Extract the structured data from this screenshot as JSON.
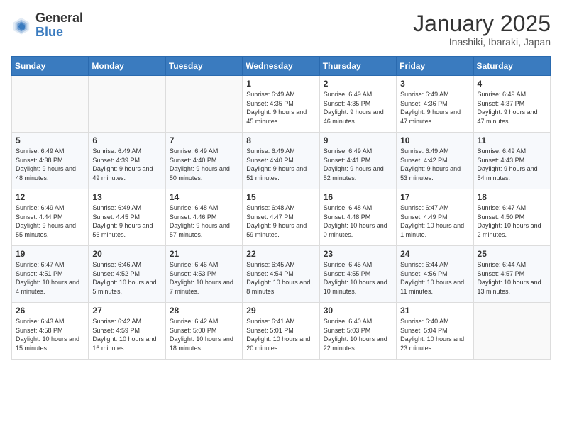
{
  "logo": {
    "general": "General",
    "blue": "Blue"
  },
  "header": {
    "title": "January 2025",
    "subtitle": "Inashiki, Ibaraki, Japan"
  },
  "weekdays": [
    "Sunday",
    "Monday",
    "Tuesday",
    "Wednesday",
    "Thursday",
    "Friday",
    "Saturday"
  ],
  "weeks": [
    [
      {
        "day": "",
        "empty": true
      },
      {
        "day": "",
        "empty": true
      },
      {
        "day": "",
        "empty": true
      },
      {
        "day": "1",
        "sunrise": "6:49 AM",
        "sunset": "4:35 PM",
        "daylight": "9 hours and 45 minutes."
      },
      {
        "day": "2",
        "sunrise": "6:49 AM",
        "sunset": "4:35 PM",
        "daylight": "9 hours and 46 minutes."
      },
      {
        "day": "3",
        "sunrise": "6:49 AM",
        "sunset": "4:36 PM",
        "daylight": "9 hours and 47 minutes."
      },
      {
        "day": "4",
        "sunrise": "6:49 AM",
        "sunset": "4:37 PM",
        "daylight": "9 hours and 47 minutes."
      }
    ],
    [
      {
        "day": "5",
        "sunrise": "6:49 AM",
        "sunset": "4:38 PM",
        "daylight": "9 hours and 48 minutes."
      },
      {
        "day": "6",
        "sunrise": "6:49 AM",
        "sunset": "4:39 PM",
        "daylight": "9 hours and 49 minutes."
      },
      {
        "day": "7",
        "sunrise": "6:49 AM",
        "sunset": "4:40 PM",
        "daylight": "9 hours and 50 minutes."
      },
      {
        "day": "8",
        "sunrise": "6:49 AM",
        "sunset": "4:40 PM",
        "daylight": "9 hours and 51 minutes."
      },
      {
        "day": "9",
        "sunrise": "6:49 AM",
        "sunset": "4:41 PM",
        "daylight": "9 hours and 52 minutes."
      },
      {
        "day": "10",
        "sunrise": "6:49 AM",
        "sunset": "4:42 PM",
        "daylight": "9 hours and 53 minutes."
      },
      {
        "day": "11",
        "sunrise": "6:49 AM",
        "sunset": "4:43 PM",
        "daylight": "9 hours and 54 minutes."
      }
    ],
    [
      {
        "day": "12",
        "sunrise": "6:49 AM",
        "sunset": "4:44 PM",
        "daylight": "9 hours and 55 minutes."
      },
      {
        "day": "13",
        "sunrise": "6:49 AM",
        "sunset": "4:45 PM",
        "daylight": "9 hours and 56 minutes."
      },
      {
        "day": "14",
        "sunrise": "6:48 AM",
        "sunset": "4:46 PM",
        "daylight": "9 hours and 57 minutes."
      },
      {
        "day": "15",
        "sunrise": "6:48 AM",
        "sunset": "4:47 PM",
        "daylight": "9 hours and 59 minutes."
      },
      {
        "day": "16",
        "sunrise": "6:48 AM",
        "sunset": "4:48 PM",
        "daylight": "10 hours and 0 minutes."
      },
      {
        "day": "17",
        "sunrise": "6:47 AM",
        "sunset": "4:49 PM",
        "daylight": "10 hours and 1 minute."
      },
      {
        "day": "18",
        "sunrise": "6:47 AM",
        "sunset": "4:50 PM",
        "daylight": "10 hours and 2 minutes."
      }
    ],
    [
      {
        "day": "19",
        "sunrise": "6:47 AM",
        "sunset": "4:51 PM",
        "daylight": "10 hours and 4 minutes."
      },
      {
        "day": "20",
        "sunrise": "6:46 AM",
        "sunset": "4:52 PM",
        "daylight": "10 hours and 5 minutes."
      },
      {
        "day": "21",
        "sunrise": "6:46 AM",
        "sunset": "4:53 PM",
        "daylight": "10 hours and 7 minutes."
      },
      {
        "day": "22",
        "sunrise": "6:45 AM",
        "sunset": "4:54 PM",
        "daylight": "10 hours and 8 minutes."
      },
      {
        "day": "23",
        "sunrise": "6:45 AM",
        "sunset": "4:55 PM",
        "daylight": "10 hours and 10 minutes."
      },
      {
        "day": "24",
        "sunrise": "6:44 AM",
        "sunset": "4:56 PM",
        "daylight": "10 hours and 11 minutes."
      },
      {
        "day": "25",
        "sunrise": "6:44 AM",
        "sunset": "4:57 PM",
        "daylight": "10 hours and 13 minutes."
      }
    ],
    [
      {
        "day": "26",
        "sunrise": "6:43 AM",
        "sunset": "4:58 PM",
        "daylight": "10 hours and 15 minutes."
      },
      {
        "day": "27",
        "sunrise": "6:42 AM",
        "sunset": "4:59 PM",
        "daylight": "10 hours and 16 minutes."
      },
      {
        "day": "28",
        "sunrise": "6:42 AM",
        "sunset": "5:00 PM",
        "daylight": "10 hours and 18 minutes."
      },
      {
        "day": "29",
        "sunrise": "6:41 AM",
        "sunset": "5:01 PM",
        "daylight": "10 hours and 20 minutes."
      },
      {
        "day": "30",
        "sunrise": "6:40 AM",
        "sunset": "5:03 PM",
        "daylight": "10 hours and 22 minutes."
      },
      {
        "day": "31",
        "sunrise": "6:40 AM",
        "sunset": "5:04 PM",
        "daylight": "10 hours and 23 minutes."
      },
      {
        "day": "",
        "empty": true
      }
    ]
  ]
}
